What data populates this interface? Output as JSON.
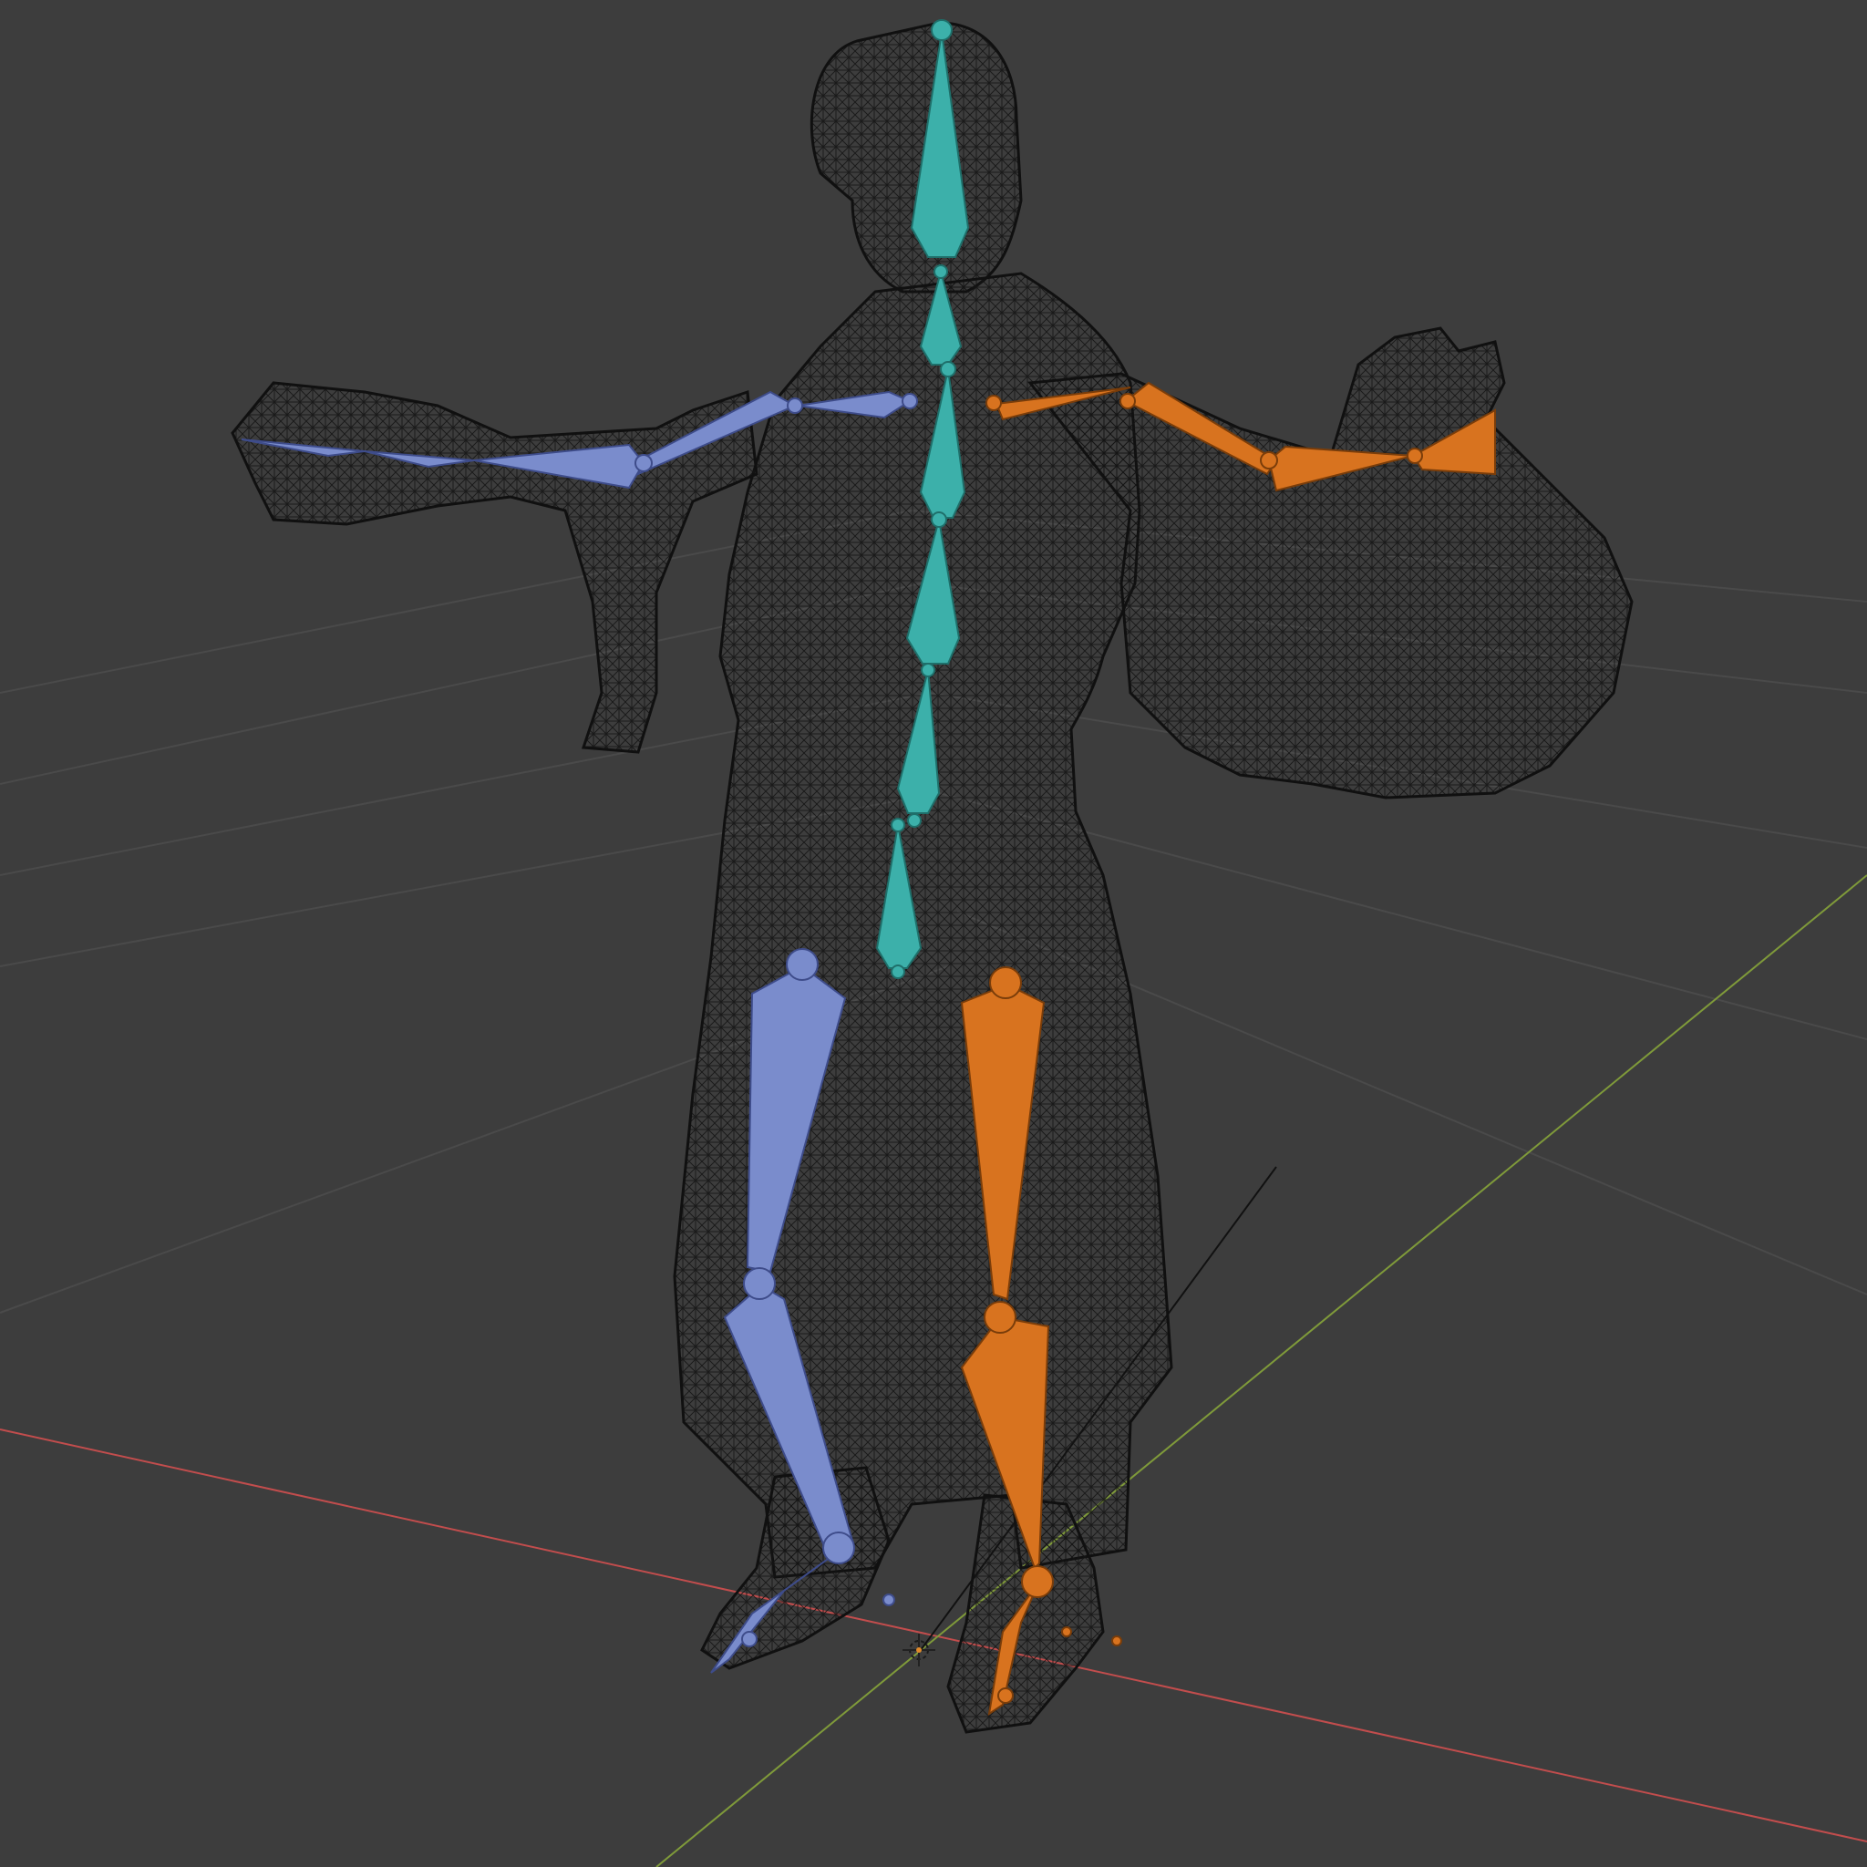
{
  "viewport": {
    "mode": "wireframe",
    "background": "#3d3d3d"
  },
  "colors": {
    "grid": "#4a4a4a",
    "x_axis": "#c24d4d",
    "y_axis": "#7f9a3a",
    "wire": "#101010",
    "spine": "#3cb0aa",
    "left_side": "#7a8ccc",
    "right_side": "#d8731f",
    "origin": "#e08a2a"
  },
  "armature": {
    "groups": [
      "spine",
      "left_side",
      "right_side"
    ]
  }
}
